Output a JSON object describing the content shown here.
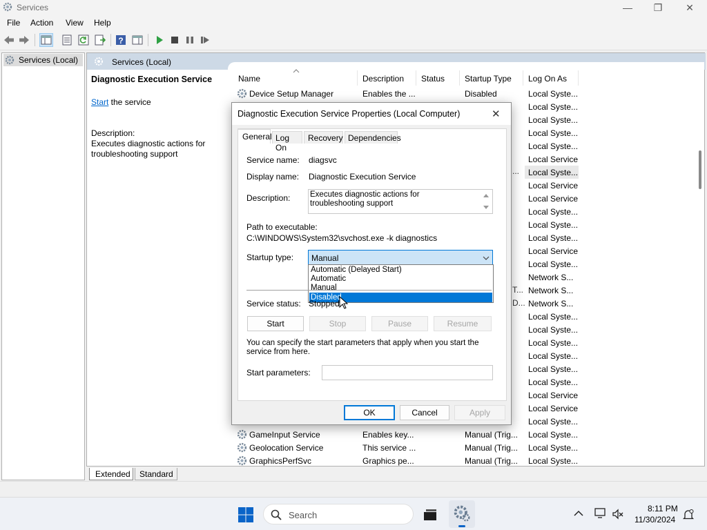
{
  "window": {
    "title": "Services",
    "minimize": "—",
    "restore": "❐",
    "close": "✕"
  },
  "menu": [
    "File",
    "Action",
    "View",
    "Help"
  ],
  "tree": {
    "item": "Services (Local)"
  },
  "main": {
    "header": "Services (Local)",
    "selected_service": "Diagnostic Execution Service",
    "start_link": "Start",
    "start_suffix": " the service",
    "description_label": "Description:",
    "description_text": "Executes diagnostic actions for troubleshooting support",
    "columns": [
      "Name",
      "Description",
      "Status",
      "Startup Type",
      "Log On As"
    ],
    "rows_top": [
      {
        "name": "Device Setup Manager",
        "description": "Enables the ...",
        "status": "",
        "startup": "Disabled",
        "logon": "Local Syste..."
      }
    ],
    "logon_column": [
      "Local Syste...",
      "Local Syste...",
      "Local Syste...",
      "Local Syste...",
      "Local Service",
      "Local Syste...",
      "Local Service",
      "Local Service",
      "Local Syste...",
      "Local Syste...",
      "Local Syste...",
      "Local Service",
      "Local Syste...",
      "Network S...",
      "Network S...",
      "Network S...",
      "Local Syste...",
      "Local Syste...",
      "Local Syste...",
      "Local Syste...",
      "Local Syste...",
      "Local Syste...",
      "Local Service",
      "Local Service",
      "Local Syste..."
    ],
    "rows_bottom": [
      {
        "name": "GameInput Service",
        "description": "Enables key...",
        "status": "",
        "startup": "Manual (Trig...",
        "logon": "Local Syste..."
      },
      {
        "name": "Geolocation Service",
        "description": "This service ...",
        "status": "",
        "startup": "Manual (Trig...",
        "logon": "Local Syste..."
      },
      {
        "name": "GraphicsPerfSvc",
        "description": "Graphics pe...",
        "status": "",
        "startup": "Manual (Trig...",
        "logon": "Local Syste..."
      }
    ],
    "tabs": [
      "Extended",
      "Standard"
    ]
  },
  "dialog": {
    "title": "Diagnostic Execution Service Properties (Local Computer)",
    "close": "✕",
    "tabs": [
      "General",
      "Log On",
      "Recovery",
      "Dependencies"
    ],
    "service_name_label": "Service name:",
    "service_name": "diagsvc",
    "display_name_label": "Display name:",
    "display_name": "Diagnostic Execution Service",
    "description_label": "Description:",
    "description": "Executes diagnostic actions for troubleshooting support",
    "path_label": "Path to executable:",
    "path": "C:\\WINDOWS\\System32\\svchost.exe -k diagnostics",
    "startup_label": "Startup type:",
    "startup_value": "Manual",
    "startup_options": [
      "Automatic (Delayed Start)",
      "Automatic",
      "Manual",
      "Disabled"
    ],
    "startup_highlighted": "Disabled",
    "status_label": "Service status:",
    "status_value": "Stopped",
    "buttons": {
      "start": "Start",
      "stop": "Stop",
      "pause": "Pause",
      "resume": "Resume"
    },
    "params_hint": "You can specify the start parameters that apply when you start the service from here.",
    "params_label": "Start parameters:",
    "params_value": "",
    "ok": "OK",
    "cancel": "Cancel",
    "apply": "Apply"
  },
  "taskbar": {
    "search_placeholder": "Search",
    "time": "8:11 PM",
    "date": "11/30/2024"
  },
  "colors": {
    "selection": "#0078d7",
    "link": "#0066cc",
    "header_bg": "#cdd9e6",
    "accent": "#0a64c8"
  }
}
